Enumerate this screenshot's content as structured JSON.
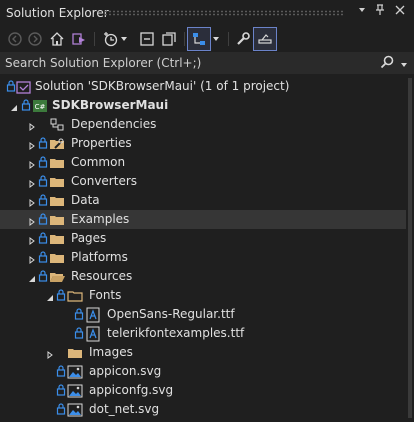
{
  "window": {
    "title": "Solution Explorer"
  },
  "search": {
    "placeholder": "Search Solution Explorer (Ctrl+;)"
  },
  "tree": {
    "solution": "Solution 'SDKBrowserMaui' (1 of 1 project)",
    "project": "SDKBrowserMaui",
    "items": [
      {
        "label": "Dependencies"
      },
      {
        "label": "Properties"
      },
      {
        "label": "Common"
      },
      {
        "label": "Converters"
      },
      {
        "label": "Data"
      },
      {
        "label": "Examples"
      },
      {
        "label": "Pages"
      },
      {
        "label": "Platforms"
      },
      {
        "label": "Resources"
      },
      {
        "label": "Fonts"
      },
      {
        "label": "OpenSans-Regular.ttf"
      },
      {
        "label": "telerikfontexamples.ttf"
      },
      {
        "label": "Images"
      },
      {
        "label": "appicon.svg"
      },
      {
        "label": "appiconfg.svg"
      },
      {
        "label": "dot_net.svg"
      }
    ]
  },
  "colors": {
    "folder": "#dcb67a",
    "lock": "#3b8eea",
    "selected_row": "#363636",
    "accent": "#6b83c9"
  }
}
